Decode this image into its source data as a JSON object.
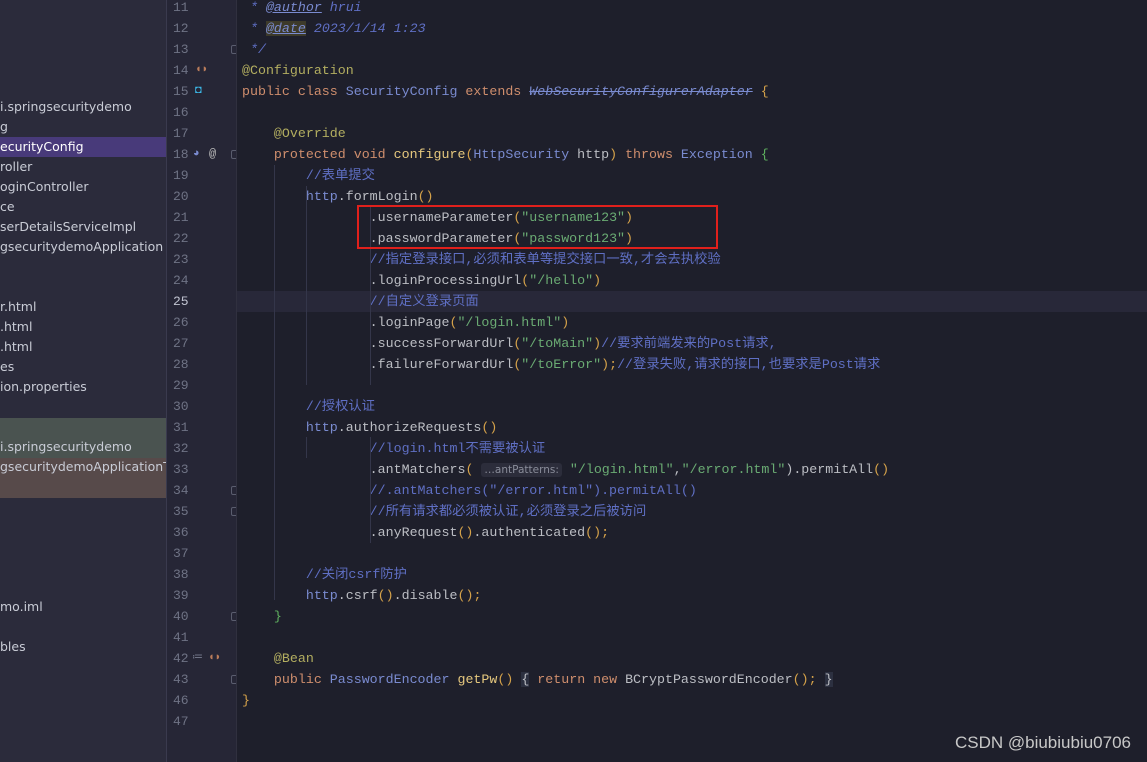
{
  "project_tree": {
    "items": [
      {
        "label": "i.springsecuritydemo",
        "row": 5
      },
      {
        "label": "g",
        "row": 6
      },
      {
        "label": "ecurityConfig",
        "row": 7,
        "selected": true
      },
      {
        "label": "roller",
        "row": 8
      },
      {
        "label": "oginController",
        "row": 9
      },
      {
        "label": "ce",
        "row": 10
      },
      {
        "label": "serDetailsServiceImpl",
        "row": 11
      },
      {
        "label": "gsecuritydemoApplication",
        "row": 12
      },
      {
        "label": "r.html",
        "row": 15
      },
      {
        "label": ".html",
        "row": 16
      },
      {
        "label": ".html",
        "row": 17
      },
      {
        "label": "es",
        "row": 18
      },
      {
        "label": "ion.properties",
        "row": 19
      },
      {
        "label": "i.springsecuritydemo",
        "row": 22
      },
      {
        "label": "gsecuritydemoApplicationTe",
        "row": 23
      },
      {
        "label": "mo.iml",
        "row": 30
      },
      {
        "label": "bles",
        "row": 32
      }
    ]
  },
  "editor": {
    "current_line": "25",
    "lines": [
      {
        "n": "11",
        "t": [
          [
            " * ",
            "t-doc"
          ],
          [
            "@author",
            "t-tag"
          ],
          [
            " hrui",
            "t-doc"
          ]
        ]
      },
      {
        "n": "12",
        "t": [
          [
            " * ",
            "t-doc"
          ],
          [
            "@date",
            "t-tagd"
          ],
          [
            " 2023/1/14 1:23",
            "t-doc"
          ]
        ]
      },
      {
        "n": "13",
        "t": [
          [
            " */",
            "t-doc"
          ]
        ]
      },
      {
        "n": "14",
        "t": [
          [
            "@Configuration",
            "t-an"
          ]
        ]
      },
      {
        "n": "15",
        "t": [
          [
            "public class ",
            "t-kw"
          ],
          [
            "SecurityConfig",
            "t-cls"
          ],
          [
            " extends ",
            "t-kw"
          ],
          [
            "WebSecurityConfigurerAdapter",
            "t-dep"
          ],
          [
            " {",
            "t-par"
          ]
        ]
      },
      {
        "n": "16",
        "t": []
      },
      {
        "n": "17",
        "t": [
          [
            "    @Override",
            "t-an"
          ]
        ]
      },
      {
        "n": "18",
        "t": [
          [
            "    protected void ",
            "t-kw"
          ],
          [
            "configure",
            "t-fn"
          ],
          [
            "(",
            "t-par"
          ],
          [
            "HttpSecurity",
            "t-cls"
          ],
          [
            " http",
            ""
          ],
          [
            ") ",
            "t-par"
          ],
          [
            "throws ",
            "t-kw"
          ],
          [
            "Exception",
            "t-cls"
          ],
          [
            " {",
            "t-br"
          ]
        ]
      },
      {
        "n": "19",
        "t": [
          [
            "        //表单提交",
            "t-cm"
          ]
        ]
      },
      {
        "n": "20",
        "t": [
          [
            "        ",
            ""
          ],
          [
            "http",
            "t-cls"
          ],
          [
            ".formLogin",
            ""
          ],
          [
            "()",
            "t-par"
          ]
        ]
      },
      {
        "n": "21",
        "t": [
          [
            "                .usernameParameter",
            ""
          ],
          [
            "(",
            "t-par"
          ],
          [
            "\"username123\"",
            "t-str"
          ],
          [
            ")",
            "t-par"
          ]
        ]
      },
      {
        "n": "22",
        "t": [
          [
            "                .passwordParameter",
            ""
          ],
          [
            "(",
            "t-par"
          ],
          [
            "\"password123\"",
            "t-str"
          ],
          [
            ")",
            "t-par"
          ]
        ]
      },
      {
        "n": "23",
        "t": [
          [
            "                //指定登录接口,必须和表单等提交接口一致,才会去执校验",
            "t-cm"
          ]
        ]
      },
      {
        "n": "24",
        "t": [
          [
            "                .loginProcessingUrl",
            ""
          ],
          [
            "(",
            "t-par"
          ],
          [
            "\"/hello\"",
            "t-str"
          ],
          [
            ")",
            "t-par"
          ]
        ]
      },
      {
        "n": "25",
        "t": [
          [
            "                //自定义登录页面",
            "t-cm"
          ]
        ]
      },
      {
        "n": "26",
        "t": [
          [
            "                .loginPage",
            ""
          ],
          [
            "(",
            "t-par"
          ],
          [
            "\"/login.html\"",
            "t-str"
          ],
          [
            ")",
            "t-par"
          ]
        ]
      },
      {
        "n": "27",
        "t": [
          [
            "                .successForwardUrl",
            ""
          ],
          [
            "(",
            "t-par"
          ],
          [
            "\"/toMain\"",
            "t-str"
          ],
          [
            ")",
            "t-par"
          ],
          [
            "//要求前端发来的Post请求,",
            "t-cm"
          ]
        ]
      },
      {
        "n": "28",
        "t": [
          [
            "                .failureForwardUrl",
            ""
          ],
          [
            "(",
            "t-par"
          ],
          [
            "\"/toError\"",
            "t-str"
          ],
          [
            ");",
            "t-par"
          ],
          [
            "//登录失败,请求的接口,也要求是Post请求",
            "t-cm"
          ]
        ]
      },
      {
        "n": "29",
        "t": []
      },
      {
        "n": "30",
        "t": [
          [
            "        //授权认证",
            "t-cm"
          ]
        ]
      },
      {
        "n": "31",
        "t": [
          [
            "        ",
            ""
          ],
          [
            "http",
            "t-cls"
          ],
          [
            ".authorizeRequests",
            ""
          ],
          [
            "()",
            "t-par"
          ]
        ]
      },
      {
        "n": "32",
        "t": [
          [
            "                //login.html不需要被认证",
            "t-cm"
          ]
        ]
      },
      {
        "n": "33",
        "t": [
          [
            "                .antMatchers",
            ""
          ],
          [
            "( ",
            "t-par"
          ],
          [
            "…antPatterns:",
            "t-hint"
          ],
          [
            " \"/login.html\"",
            "t-str"
          ],
          [
            ",",
            ""
          ],
          [
            "\"/error.html\"",
            "t-str"
          ],
          [
            ")",
            ""
          ],
          [
            ".permitAll",
            ""
          ],
          [
            "()",
            "t-par"
          ]
        ]
      },
      {
        "n": "34",
        "t": [
          [
            "                //.antMatchers(\"/error.html\").permitAll()",
            "t-cm"
          ]
        ]
      },
      {
        "n": "35",
        "t": [
          [
            "                //所有请求都必须被认证,必须登录之后被访问",
            "t-cm"
          ]
        ]
      },
      {
        "n": "36",
        "t": [
          [
            "                .anyRequest",
            ""
          ],
          [
            "()",
            "t-par"
          ],
          [
            ".authenticated",
            ""
          ],
          [
            "();",
            "t-par"
          ]
        ]
      },
      {
        "n": "37",
        "t": []
      },
      {
        "n": "38",
        "t": [
          [
            "        //关闭csrf防护",
            "t-cm"
          ]
        ]
      },
      {
        "n": "39",
        "t": [
          [
            "        ",
            ""
          ],
          [
            "http",
            "t-cls"
          ],
          [
            ".csrf",
            ""
          ],
          [
            "()",
            "t-par"
          ],
          [
            ".disable",
            ""
          ],
          [
            "();",
            "t-par"
          ]
        ]
      },
      {
        "n": "40",
        "t": [
          [
            "    }",
            "t-br"
          ]
        ]
      },
      {
        "n": "41",
        "t": []
      },
      {
        "n": "42",
        "t": [
          [
            "    @Bean",
            "t-an"
          ]
        ]
      },
      {
        "n": "43",
        "t": [
          [
            "    public ",
            "t-kw"
          ],
          [
            "PasswordEncoder",
            "t-cls"
          ],
          [
            " getPw",
            "t-fn"
          ],
          [
            "()",
            "t-par"
          ],
          [
            " ",
            ""
          ],
          [
            "{",
            "t-bg"
          ],
          [
            " return new ",
            "t-kw"
          ],
          [
            "BCryptPasswordEncoder",
            ""
          ],
          [
            "();",
            "t-par"
          ],
          [
            " ",
            ""
          ],
          [
            "}",
            "t-bg"
          ]
        ]
      },
      {
        "n": "46",
        "t": [
          [
            "}",
            "t-par"
          ]
        ]
      },
      {
        "n": "47",
        "t": []
      }
    ]
  },
  "watermark": "CSDN @biubiubiu0706"
}
